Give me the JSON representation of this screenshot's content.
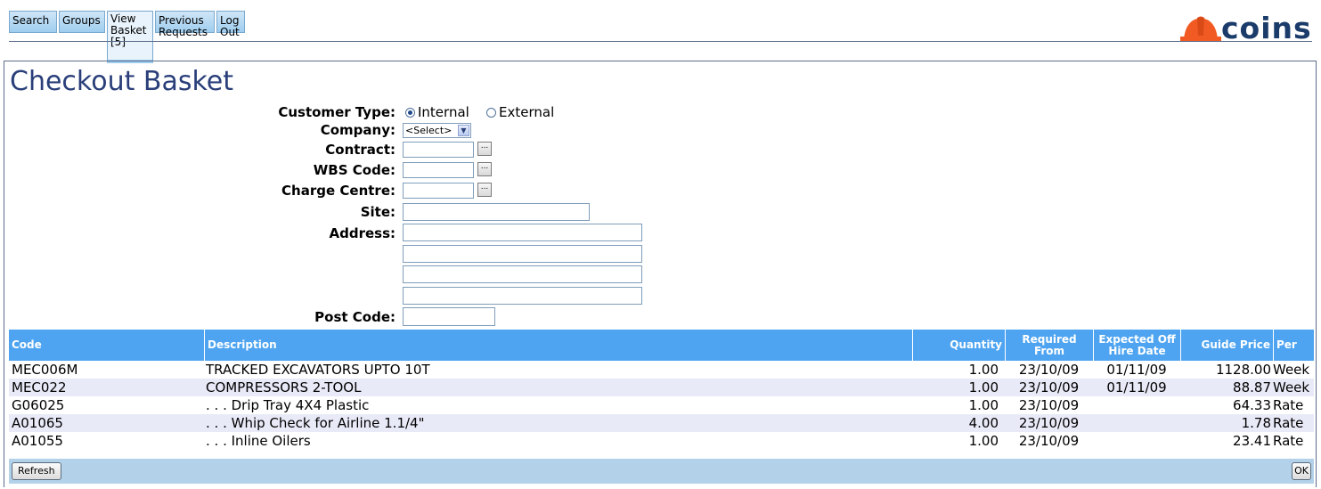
{
  "nav": {
    "tabs": [
      {
        "label": "Search"
      },
      {
        "label": "Groups"
      },
      {
        "label": "View\nBasket\n[5]"
      },
      {
        "label": "Previous\nRequests"
      },
      {
        "label": "Log\nOut"
      }
    ]
  },
  "logo": {
    "text": "coins",
    "color": "#1b3c6b",
    "accent": "#f15a22"
  },
  "page": {
    "title": "Checkout Basket"
  },
  "form": {
    "customer_type_label": "Customer Type:",
    "internal_label": "Internal",
    "external_label": "External",
    "customer_type_selected": "Internal",
    "company_label": "Company:",
    "company_value": "<Select>",
    "contract_label": "Contract:",
    "wbs_label": "WBS Code:",
    "charge_centre_label": "Charge Centre:",
    "site_label": "Site:",
    "address_label": "Address:",
    "post_code_label": "Post Code:",
    "browse_label": "..."
  },
  "table": {
    "headers": {
      "code": "Code",
      "description": "Description",
      "quantity": "Quantity",
      "required_from": "Required From",
      "expected_off_hire": "Expected Off Hire Date",
      "guide_price": "Guide Price",
      "per": "Per"
    },
    "rows": [
      {
        "code": "MEC006M",
        "description": "TRACKED EXCAVATORS UPTO 10T",
        "quantity": "1.00",
        "required_from": "23/10/09",
        "expected_off_hire": "01/11/09",
        "guide_price": "1128.00",
        "per": "Week"
      },
      {
        "code": "MEC022",
        "description": "COMPRESSORS 2-TOOL",
        "quantity": "1.00",
        "required_from": "23/10/09",
        "expected_off_hire": "01/11/09",
        "guide_price": "88.87",
        "per": "Week"
      },
      {
        "code": "G06025",
        "description": ". . . Drip Tray 4X4 Plastic",
        "quantity": "1.00",
        "required_from": "23/10/09",
        "expected_off_hire": "",
        "guide_price": "64.33",
        "per": "Rate"
      },
      {
        "code": "A01065",
        "description": ". . . Whip Check for Airline 1.1/4\"",
        "quantity": "4.00",
        "required_from": "23/10/09",
        "expected_off_hire": "",
        "guide_price": "1.78",
        "per": "Rate"
      },
      {
        "code": "A01055",
        "description": ". . . Inline Oilers",
        "quantity": "1.00",
        "required_from": "23/10/09",
        "expected_off_hire": "",
        "guide_price": "23.41",
        "per": "Rate"
      }
    ]
  },
  "footer": {
    "refresh_label": "Refresh",
    "ok_label": "OK"
  }
}
